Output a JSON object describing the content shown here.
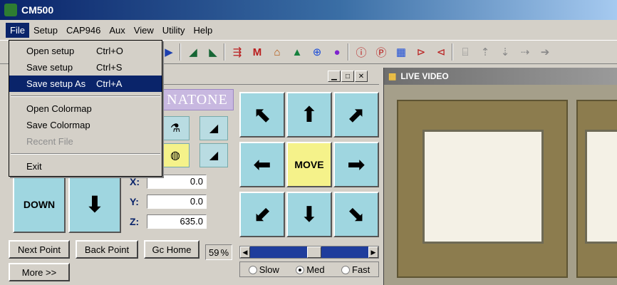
{
  "app": {
    "title": "CM500"
  },
  "menubar": {
    "items": [
      "File",
      "Setup",
      "CAP946",
      "Aux",
      "View",
      "Utility",
      "Help"
    ]
  },
  "file_menu": {
    "items": [
      {
        "label": "Open setup",
        "shortcut": "Ctrl+O"
      },
      {
        "label": "Save setup",
        "shortcut": "Ctrl+S"
      },
      {
        "label": "Save setup As",
        "shortcut": "Ctrl+A"
      },
      {
        "label": "Open Colormap",
        "shortcut": ""
      },
      {
        "label": "Save Colormap",
        "shortcut": ""
      },
      {
        "label": "Recent File",
        "shortcut": ""
      },
      {
        "label": "Exit",
        "shortcut": ""
      }
    ]
  },
  "control": {
    "banner": "NATONE",
    "coords": {
      "x_label": "X:",
      "x": "0.0",
      "y_label": "Y:",
      "y": "0.0",
      "z_label": "Z:",
      "z": "635.0"
    },
    "down_label": "DOWN",
    "move_label": "MOVE",
    "buttons": {
      "next": "Next Point",
      "back": "Back Point",
      "home": "Gc Home",
      "more": "More >>"
    },
    "speed_percent": "59",
    "pct_symbol": "%",
    "speed_options": [
      "Slow",
      "Med",
      "Fast"
    ],
    "selected_speed": "Med"
  },
  "video": {
    "title": "LIVE VIDEO"
  }
}
